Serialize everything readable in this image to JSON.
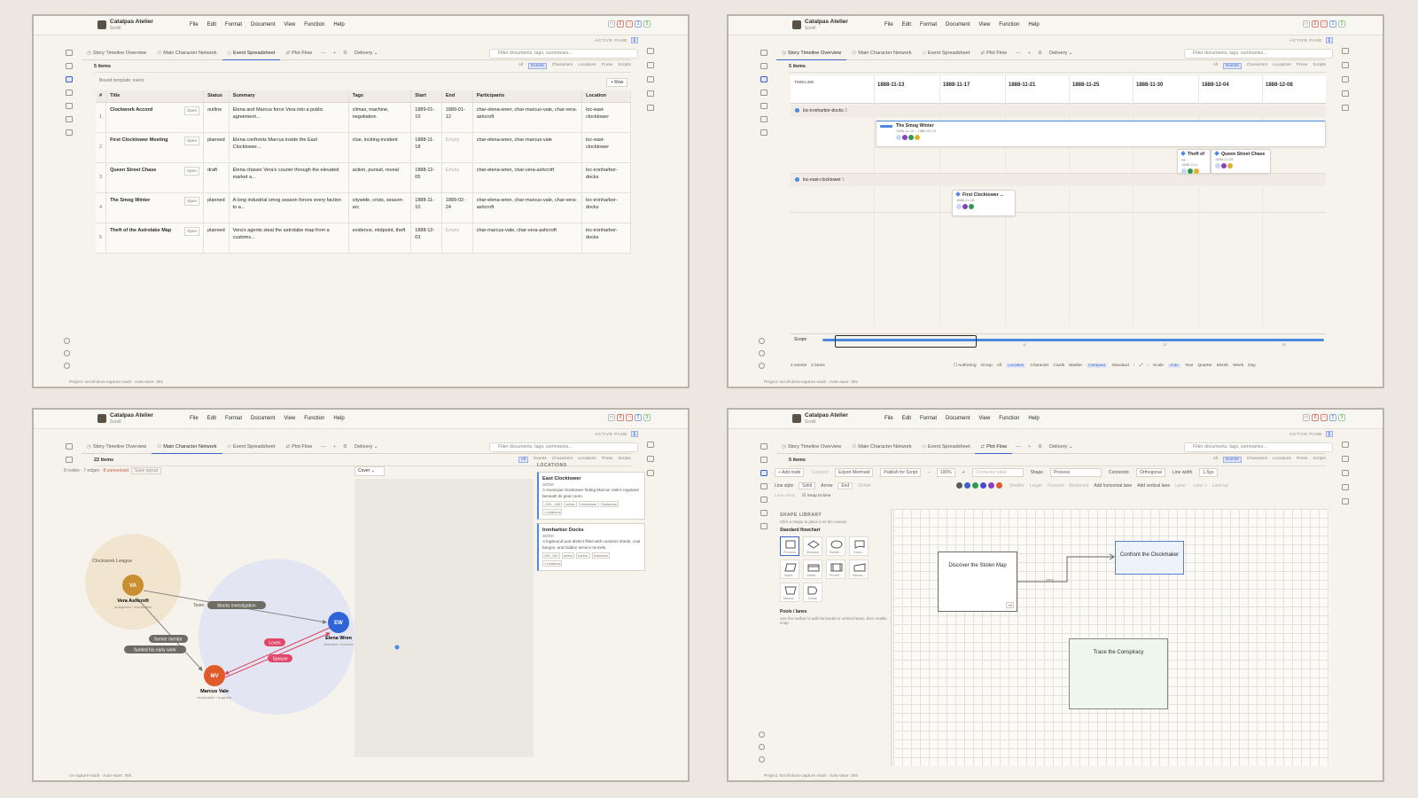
{
  "app": {
    "name": "Catalpas Atelier",
    "subtitle": "Scroll"
  },
  "menus": [
    "File",
    "Edit",
    "Format",
    "Document",
    "View",
    "Function",
    "Help"
  ],
  "active_pane": {
    "label": "ACTIVE PANE",
    "value": "1"
  },
  "window_controls": [
    "□",
    "6",
    "□",
    "2",
    "3"
  ],
  "tabs": [
    "Story Timeline Overview",
    "Main Character Network",
    "Event Spreadsheet",
    "Plot Flow"
  ],
  "tab_tools": [
    "—",
    "+",
    "⚙"
  ],
  "delivery": "Delivery",
  "search_placeholder": "Filter documents, tags, summaries...",
  "filters": [
    "All",
    "Events",
    "Characters",
    "Locations",
    "Prose",
    "Scripts"
  ],
  "status": {
    "project": "Project: scroll-docs-capture-vault",
    "autosave": "Auto-save: 30s",
    "project_short": "cx-capture-vault"
  },
  "spreadsheet": {
    "count": "5 items",
    "bound": "Bound template: event",
    "add_row": "+ Row",
    "columns": [
      "#",
      "Title",
      "Status",
      "Summary",
      "Tags",
      "Start",
      "End",
      "Participants",
      "Location"
    ],
    "open_label": "Open",
    "rows": [
      {
        "n": "1",
        "title": "Clockwork Accord",
        "status": "outline",
        "summary": "Elena and Marcus force Vera into a public agreement...",
        "tags": "climax, machine, negotiation",
        "start": "1889-01-10",
        "end": "1889-01-12",
        "participants": "char-elena-wren, char-marcus-vale, char-vera-ashcroft",
        "location": "loc-east-clocktower"
      },
      {
        "n": "2",
        "title": "First Clocktower Meeting",
        "status": "planned",
        "summary": "Elena confronts Marcus inside the East Clocktower...",
        "tags": "clue, inciting-incident",
        "start": "1888-11-18",
        "end": "Empty",
        "participants": "char-elena-wren, char-marcus-vale",
        "location": "loc-east-clocktower"
      },
      {
        "n": "3",
        "title": "Queen Street Chase",
        "status": "draft",
        "summary": "Elena chases Vera's courier through the elevated market a...",
        "tags": "action, pursuit, reveal",
        "start": "1888-12-05",
        "end": "Empty",
        "participants": "char-elena-wren, char-vera-ashcroft",
        "location": "loc-ironharbor-docks"
      },
      {
        "n": "4",
        "title": "The Smog Winter",
        "status": "planned",
        "summary": "A long industrial smog season forces every faction to a...",
        "tags": "citywide, crisis, season-arc",
        "start": "1888-11-10",
        "end": "1889-02-24",
        "participants": "char-elena-wren, char-marcus-vale, char-vera-ashcroft",
        "location": "loc-ironharbor-docks"
      },
      {
        "n": "5",
        "title": "Theft of the Astrolabe Map",
        "status": "planned",
        "summary": "Vera's agents steal the astrolabe map from a customs...",
        "tags": "evidence, midpoint, theft",
        "start": "1888-12-03",
        "end": "Empty",
        "participants": "char-marcus-vale, char-vera-ashcroft",
        "location": "loc-ironharbor-docks"
      }
    ]
  },
  "timeline": {
    "count": "5 items",
    "label": "TIMELINE",
    "dates": [
      "1888-11-13",
      "1888-11-17",
      "1888-11-21",
      "1888-11-25",
      "1888-11-30",
      "1888-12-04",
      "1888-12-08"
    ],
    "lanes": [
      {
        "name": "loc-ironharbor-docks",
        "count": "3"
      },
      {
        "name": "loc-east-clocktower",
        "count": "1"
      }
    ],
    "events": [
      {
        "title": "The Smog Winter",
        "dates": "1888-11-10 – 1889-02-24"
      },
      {
        "title": "Theft of ...",
        "dates": "1888-12-0"
      },
      {
        "title": "Queen Street Chase",
        "dates": "1888-12-05"
      },
      {
        "title": "First Clocktower ...",
        "dates": "1888-11-18"
      }
    ],
    "scope_label": "Scope",
    "scope_ticks": [
      "11",
      "12",
      "'02"
    ],
    "footer": {
      "events": "4 events",
      "lanes": "2 lanes",
      "authoring": "Authoring",
      "group": "Group",
      "group_opts": [
        "All",
        "Location",
        "Character"
      ],
      "cards": "Cards",
      "card_opts": [
        "Marker",
        "Compact",
        "Standard"
      ],
      "scale": "Scale",
      "scale_opts": [
        "Auto",
        "Year",
        "Quarter",
        "Month",
        "Week",
        "Day"
      ]
    }
  },
  "network": {
    "count": "22 items",
    "nodes_label": "8 nodes",
    "edges_label": "7 edges",
    "unresolved": "8 unresolved",
    "save_layout": "Save layout",
    "cover": "Cover",
    "group_label": "Clockwork League",
    "team_label": "Team",
    "characters": [
      {
        "initials": "VA",
        "name": "Vera Ashcroft",
        "role": "antagonist / industrialist",
        "color": "#c98e2f"
      },
      {
        "initials": "EW",
        "name": "Elena Wren",
        "role": "detective / inventor",
        "color": "#2f64d6"
      },
      {
        "initials": "MV",
        "name": "Marcus Vale",
        "role": "clockmaker / engineer",
        "color": "#e05a2a"
      }
    ],
    "edges": [
      "blocks investigation",
      "former mentor",
      "funded his early work",
      "Loves",
      "Spouse"
    ],
    "locations_head": "LOCATIONS",
    "locations": [
      {
        "name": "East Clocktower",
        "status": "active",
        "desc": "A municipal clocktower hiding Marcus Vale's regulator beneath its gear room.",
        "tags": [
          "-290, -165",
          "active",
          "clocktower",
          "landmark"
        ],
        "relations": "1 relations"
      },
      {
        "name": "Ironharbor Docks",
        "status": "active",
        "desc": "A fogbound port district filled with customs sheds, coal barges, and hidden service tunnels.",
        "tags": [
          "240, 160",
          "active",
          "harbor",
          "industrial"
        ],
        "relations": "1 relations"
      }
    ]
  },
  "flow": {
    "count": "5 items",
    "toolbar": [
      "+ Add node",
      "Connect",
      "Export Mermaid",
      "Publish for Script",
      "-",
      "100%",
      "+"
    ],
    "connector_placeholder": "Connector label",
    "shape_label": "Shape",
    "shape_value": "Process",
    "connector_label": "Connector",
    "connector_value": "Orthogonal",
    "linewidth_label": "Line width",
    "linewidth_value": "1.5px",
    "line_style_label": "Line style",
    "line_style_value": "Solid",
    "arrow_label": "Arrow",
    "arrow_value": "End",
    "delete": "Delete",
    "swatches": [
      "#5a5a5a",
      "#3d63c9",
      "#2e9a4e",
      "#4b4bc9",
      "#8a3fc0",
      "#e05a2a"
    ],
    "row2": [
      "Smaller",
      "Larger",
      "Forward",
      "Backward",
      "Add horizontal lane",
      "Add vertical lane",
      "Lane -",
      "Lane +",
      "Lane up"
    ],
    "row3": [
      "Lane down"
    ],
    "snap": "Snap to lane",
    "library_head": "SHAPE LIBRARY",
    "library_sub": "Click a shape to place it on the canvas.",
    "standard": "Standard flowchart",
    "shapes": [
      "Process",
      "Decision",
      "Startle...",
      "Docu...",
      "Input/...",
      "Datab...",
      "Predef...",
      "Manua...",
      "Manua...",
      "Delay"
    ],
    "pools_head": "Pools / lanes",
    "pools_sub": "Use the toolbar to add horizontal or vertical lanes, then enable snap.",
    "nodes": [
      "Discover the Stolen Map",
      "Confront the Clockmaker",
      "Trace the Conspiracy"
    ],
    "edge_label": "YES",
    "node_badge": "+1"
  }
}
